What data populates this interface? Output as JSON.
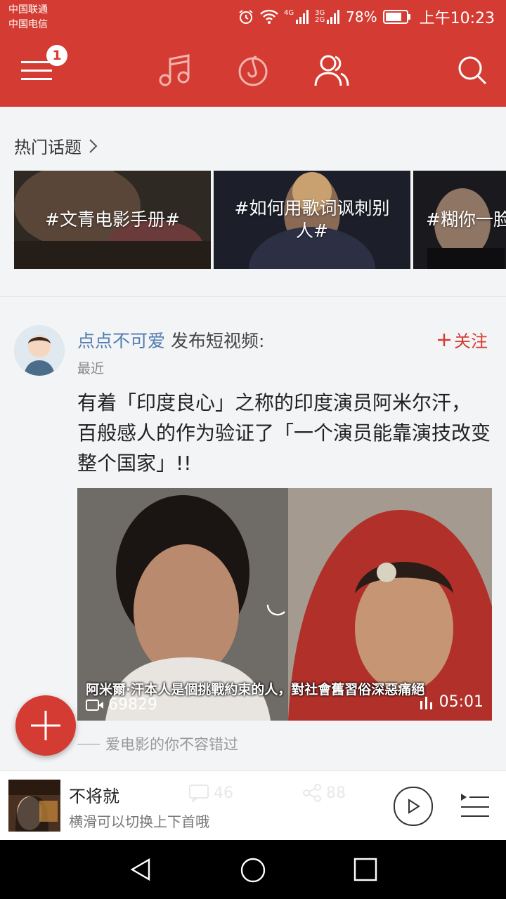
{
  "status_bar": {
    "carrier_1": "中国联通",
    "carrier_2": "中国电信",
    "network_1": "4G",
    "network_2": "3G 2G",
    "battery": "78%",
    "time": "上午10:23"
  },
  "nav": {
    "menu_badge": "1",
    "icons": [
      "menu-icon",
      "music-note-icon",
      "netease-music-icon",
      "friends-icon",
      "search-icon"
    ]
  },
  "hot_topics": {
    "title": "热门话题",
    "items": [
      {
        "label": "#文青电影手册#"
      },
      {
        "label": "#如何用歌词讽刺别人#"
      },
      {
        "label": "#糊你一脸汤"
      }
    ]
  },
  "post": {
    "user": "点点不可爱",
    "action": "发布短视频:",
    "time": "最近",
    "follow_label": "关注",
    "text": "有着「印度良心」之称的印度演员阿米尔汗， 百般感人的作为验证了「一个演员能靠演技改变整个国家」!!",
    "video": {
      "subtitle": "阿米爾·汗本人是個挑戰約束的人，對社會舊習俗深惡痛絕",
      "views": "69829",
      "duration": "05:01"
    },
    "caption": "爱电影的你不容错过"
  },
  "player": {
    "song": "不将就",
    "hint": "横滑可以切换上下首哦",
    "ghost_comments": "46",
    "ghost_shares": "88"
  },
  "colors": {
    "brand_red": "#d43c33",
    "link_blue": "#507daf"
  }
}
